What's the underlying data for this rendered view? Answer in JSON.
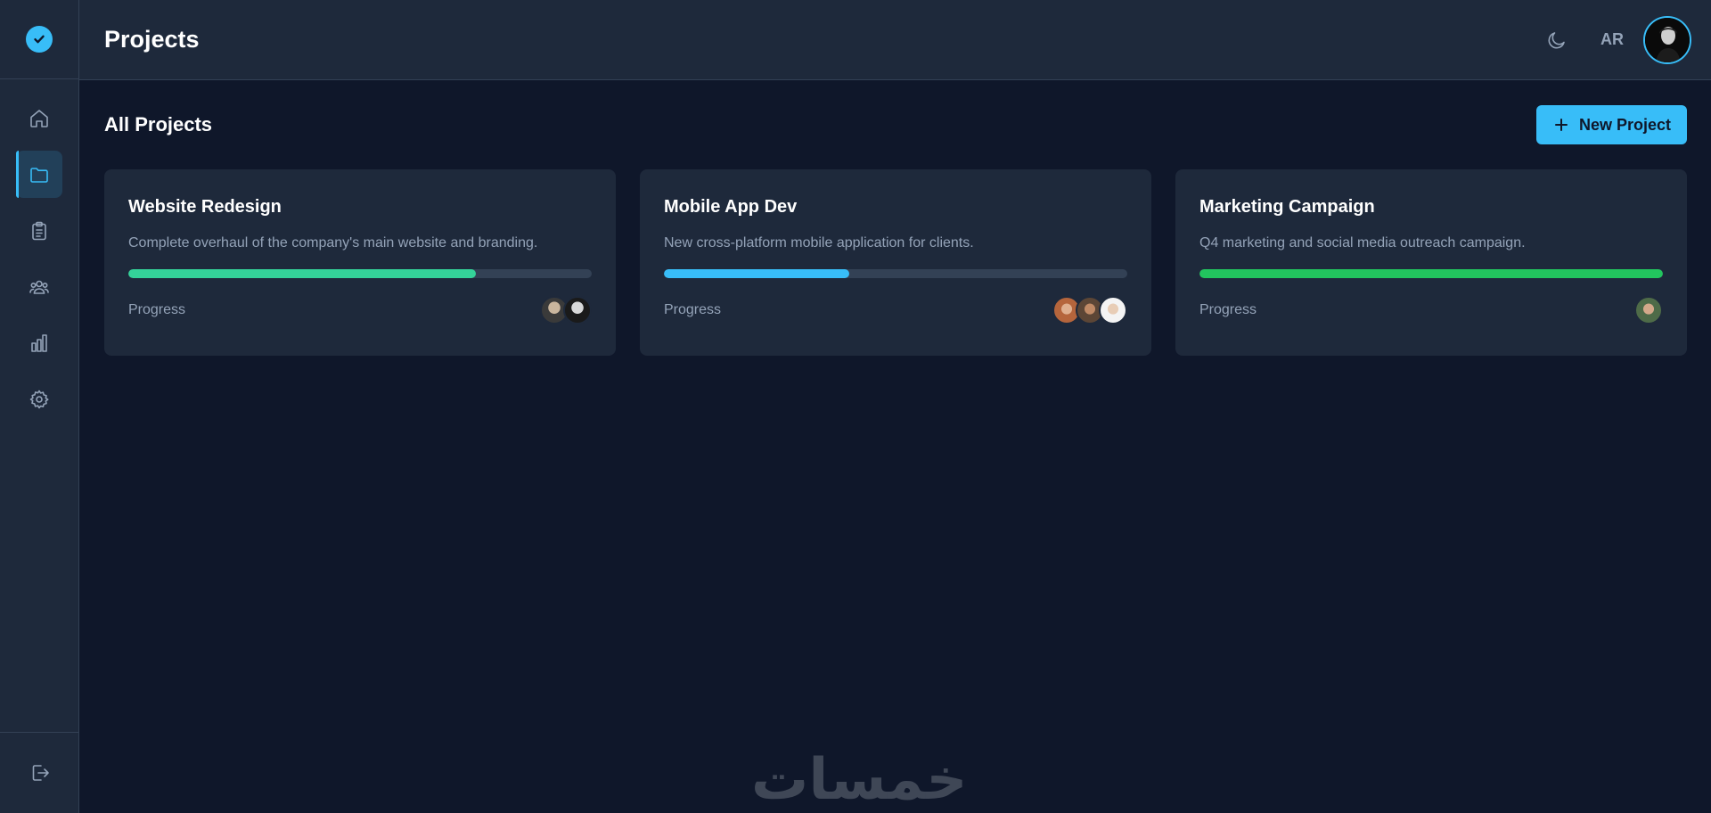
{
  "header": {
    "title": "Projects",
    "user_initials": "AR"
  },
  "sidebar": {
    "items": [
      {
        "name": "home-icon",
        "active": false
      },
      {
        "name": "folder-icon",
        "active": true
      },
      {
        "name": "clipboard-icon",
        "active": false
      },
      {
        "name": "users-icon",
        "active": false
      },
      {
        "name": "chart-icon",
        "active": false
      },
      {
        "name": "settings-icon",
        "active": false
      }
    ],
    "logout_icon": "logout-icon"
  },
  "main": {
    "section_title": "All Projects",
    "new_button_label": "New Project",
    "projects": [
      {
        "title": "Website Redesign",
        "description": "Complete overhaul of the company's main website and branding.",
        "progress_label": "Progress",
        "progress": 0.75,
        "color": "#34d399",
        "avatars": 2
      },
      {
        "title": "Mobile App Dev",
        "description": "New cross-platform mobile application for clients.",
        "progress_label": "Progress",
        "progress": 0.4,
        "color": "#38bdf8",
        "avatars": 3
      },
      {
        "title": "Marketing Campaign",
        "description": "Q4 marketing and social media outreach campaign.",
        "progress_label": "Progress",
        "progress": 1.0,
        "color": "#22c55e",
        "avatars": 1
      }
    ]
  },
  "watermark": "خمسات",
  "colors": {
    "accent": "#38bdf8",
    "background": "#0f172a",
    "surface": "#1e293b"
  }
}
